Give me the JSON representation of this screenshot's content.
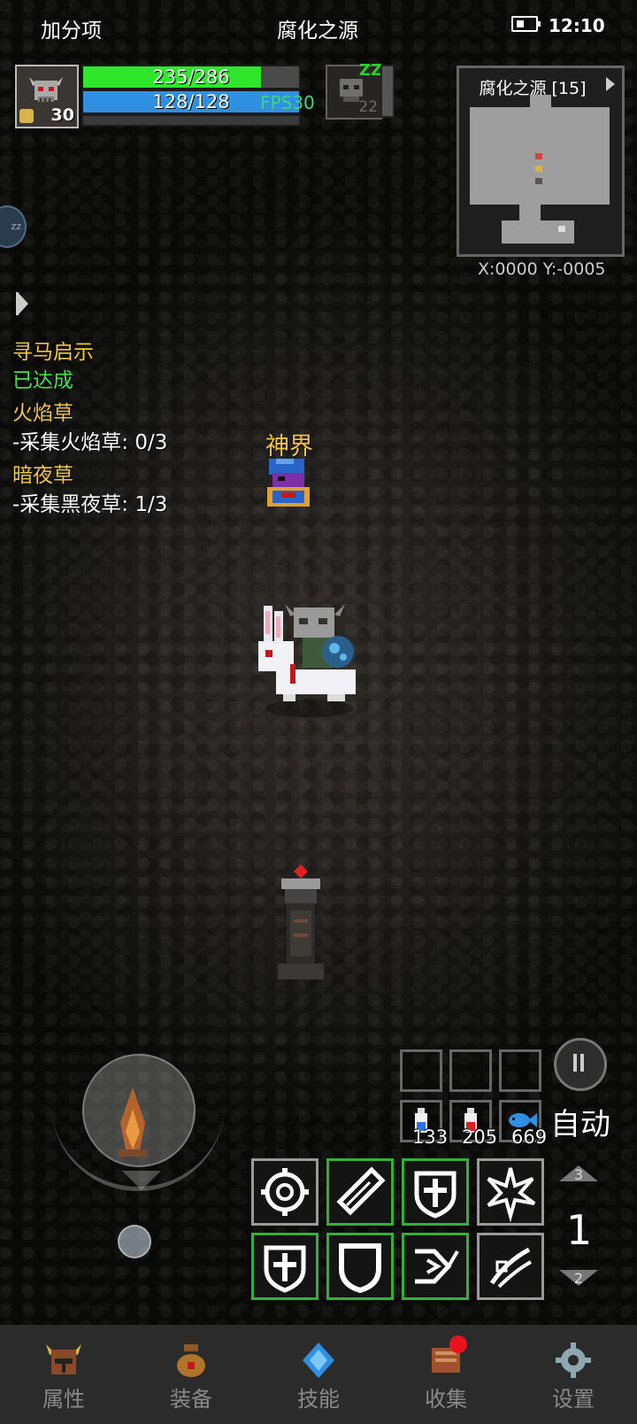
{
  "status_bar": {
    "left_text": "加分项",
    "center_text": "腐化之源",
    "time": "12:10"
  },
  "player": {
    "level": "30",
    "hp_text": "235/286",
    "hp_fraction": 0.822,
    "mp_text": "128/128",
    "mp_fraction": 1.0,
    "fps": "FPS30"
  },
  "pet": {
    "level": "22"
  },
  "minimap": {
    "title": "腐化之源 [15]",
    "coords": "X:0000  Y:-0005"
  },
  "quests": [
    {
      "title": "寻马启示",
      "detail": "已达成"
    },
    {
      "title": "火焰草",
      "detail": "-采集火焰草: 0/3"
    },
    {
      "title": "暗夜草",
      "detail": "-采集黑夜草: 1/3"
    }
  ],
  "npc": {
    "name": "神界"
  },
  "consumables": [
    {
      "icon": "blue-potion-icon",
      "count": "133"
    },
    {
      "icon": "red-potion-icon",
      "count": "205"
    },
    {
      "icon": "fish-icon",
      "count": "669"
    }
  ],
  "controls": {
    "auto_label": "自动",
    "page_current": "1",
    "page_up": "3",
    "page_down": "2"
  },
  "skills": [
    {
      "icon": "gear-skill-icon",
      "style": "grey"
    },
    {
      "icon": "blade-skill-icon",
      "style": "green"
    },
    {
      "icon": "shield-cross-skill-icon",
      "style": "green"
    },
    {
      "icon": "burst-skill-icon",
      "style": "grey"
    },
    {
      "icon": "shield-cross-skill-icon",
      "style": "green"
    },
    {
      "icon": "shield-skill-icon",
      "style": "green"
    },
    {
      "icon": "dash-skill-icon",
      "style": "green"
    },
    {
      "icon": "slash-skill-icon",
      "style": "grey"
    }
  ],
  "nav": [
    {
      "label": "属性",
      "icon": "helmet-icon"
    },
    {
      "label": "装备",
      "icon": "bag-icon"
    },
    {
      "label": "技能",
      "icon": "crystal-icon"
    },
    {
      "label": "收集",
      "icon": "book-icon",
      "has_notification": true
    },
    {
      "label": "设置",
      "icon": "gear-icon"
    }
  ]
}
